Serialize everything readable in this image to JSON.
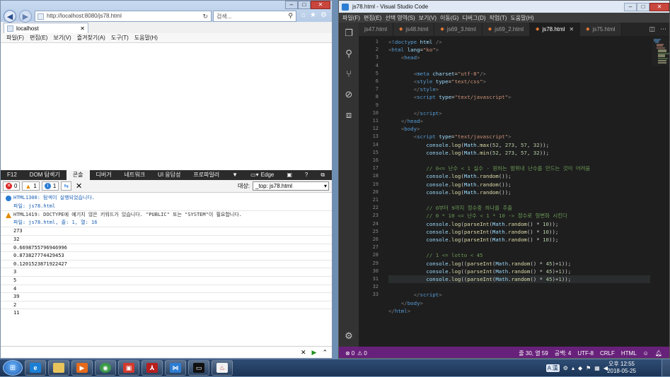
{
  "ie": {
    "address": "http://localhost:8080/js78.html",
    "address_host": "localhost",
    "search_placeholder": "검색...",
    "tab_label": "localhost",
    "menu": [
      "파일(F)",
      "편집(E)",
      "보기(V)",
      "즐겨찾기(A)",
      "도구(T)",
      "도움말(H)"
    ],
    "devtools": {
      "tabs": [
        "F12",
        "DOM 탐색기",
        "콘솔",
        "디버거",
        "네트워크",
        "UI 응답성",
        "프로파일러"
      ],
      "active_tab": "콘솔",
      "emulation": "Edge",
      "error_count": "0",
      "warning_count": "1",
      "info_count": "1",
      "target_label": "대상:",
      "target_value": "_top: js78.html",
      "messages": [
        {
          "type": "info",
          "text": "HTML1300: 탐색이 실행되었습니다.",
          "file": "파일: js78.html"
        },
        {
          "type": "warning",
          "text": "HTML1419: DOCTYPE에 예기치 않은 키워드가 있습니다. \"PUBLIC\" 또는 \"SYSTEM\"이 필요합니다.",
          "file": "파일: js78.html, 줄: 1, 열: 16"
        }
      ],
      "output": [
        "273",
        "32",
        "0.6698755796946996",
        "0.873827774429453",
        "0.1201523871922427",
        "3",
        "5",
        "4",
        "39",
        "2",
        "11"
      ]
    }
  },
  "vscode": {
    "window_title": "js78.html - Visual Studio Code",
    "menu": [
      "파일(F)",
      "편집(E)",
      "선택 영역(S)",
      "보기(V)",
      "이동(G)",
      "디버그(D)",
      "작업(T)",
      "도움말(H)"
    ],
    "tabs": [
      {
        "label": "js47.html",
        "active": false
      },
      {
        "label": "js48.html",
        "active": false
      },
      {
        "label": "js69_3.html",
        "active": false
      },
      {
        "label": "js69_2.html",
        "active": false
      },
      {
        "label": "js78.html",
        "active": true
      },
      {
        "label": "js75.html",
        "active": false
      }
    ],
    "line_numbers": [
      "1",
      "2",
      "3",
      "4",
      "5",
      "6",
      "7",
      "8",
      "9",
      "10",
      "11",
      "12",
      "13",
      "14",
      "15",
      "16",
      "17",
      "18",
      "19",
      "20",
      "21",
      "22",
      "23",
      "24",
      "25",
      "26",
      "27",
      "28",
      "29",
      "30",
      "31",
      "32",
      "33"
    ],
    "status": {
      "errors": "0",
      "warnings": "0",
      "position": "줄 30, 열 59",
      "spaces": "공백: 4",
      "encoding": "UTF-8",
      "eol": "CRLF",
      "language": "HTML"
    }
  },
  "taskbar": {
    "time": "오후 12:55",
    "date": "2018-05-25",
    "ime": "A 漢"
  },
  "colors": {
    "vscode_status": "#68217a",
    "editor_bg": "#1e1e1e",
    "keyword": "#569cd6",
    "string": "#ce9178",
    "comment": "#6a9955"
  }
}
